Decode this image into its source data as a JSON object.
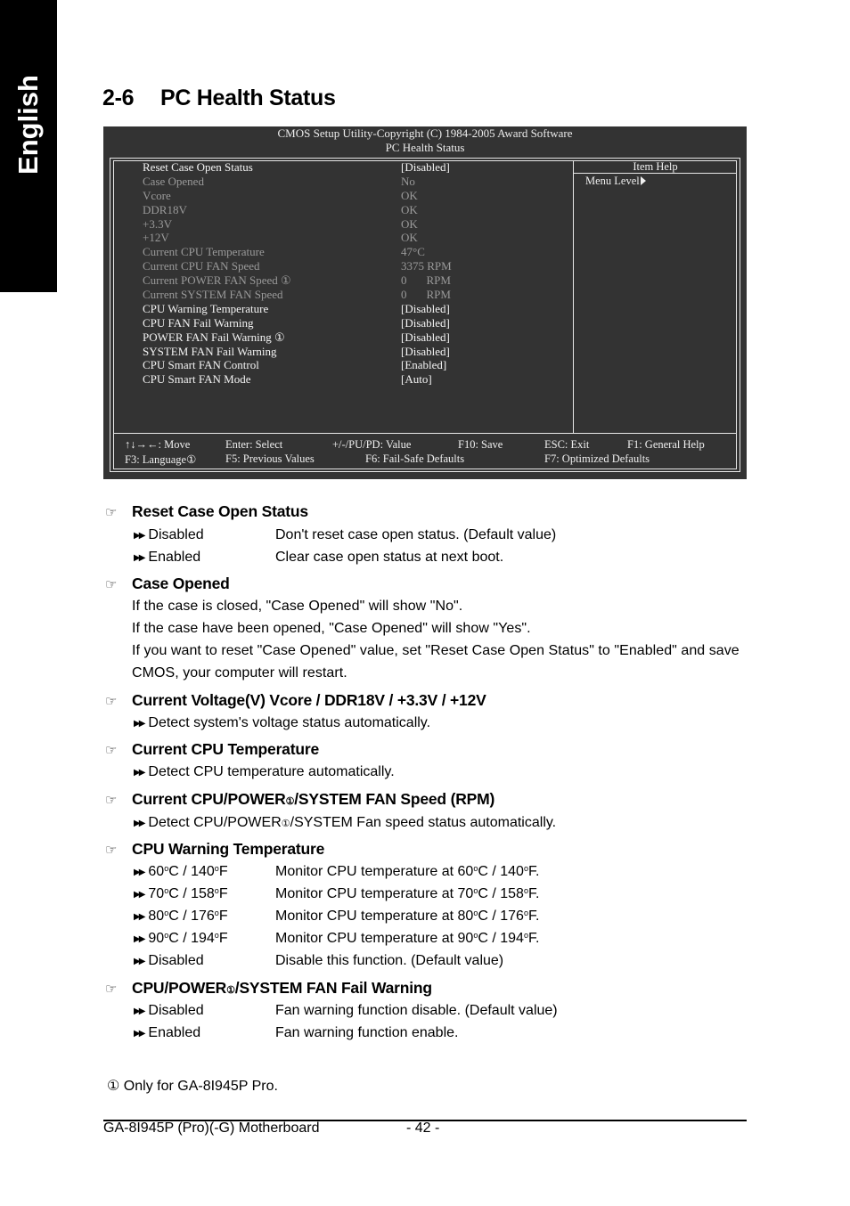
{
  "side_tab": {
    "label": "English"
  },
  "page_title": {
    "number": "2-6",
    "text": "PC Health Status"
  },
  "bios": {
    "header_line1": "CMOS Setup Utility-Copyright (C) 1984-2005 Award Software",
    "header_line2": "PC Health Status",
    "rows": [
      {
        "label": "Reset Case Open Status",
        "value": "[Disabled]",
        "state": "active"
      },
      {
        "label": "Case Opened",
        "value": "No",
        "state": "readonly"
      },
      {
        "label": "Vcore",
        "value": "OK",
        "state": "readonly"
      },
      {
        "label": "DDR18V",
        "value": "OK",
        "state": "readonly"
      },
      {
        "label": "+3.3V",
        "value": "OK",
        "state": "readonly"
      },
      {
        "label": "+12V",
        "value": "OK",
        "state": "readonly"
      },
      {
        "label": "Current CPU Temperature",
        "value": "47°C",
        "state": "readonly"
      },
      {
        "label": "Current CPU FAN Speed",
        "value": "3375 RPM",
        "state": "readonly"
      },
      {
        "label": "Current POWER FAN Speed ①",
        "value": "0",
        "unit": "RPM",
        "state": "readonly"
      },
      {
        "label": "Current SYSTEM FAN Speed",
        "value": "0",
        "unit": "RPM",
        "state": "readonly"
      },
      {
        "label": "CPU Warning Temperature",
        "value": "[Disabled]",
        "state": "active"
      },
      {
        "label": "CPU FAN Fail Warning",
        "value": "[Disabled]",
        "state": "active"
      },
      {
        "label": "POWER FAN Fail Warning ①",
        "value": "[Disabled]",
        "state": "active"
      },
      {
        "label": "SYSTEM FAN Fail Warning",
        "value": "[Disabled]",
        "state": "active"
      },
      {
        "label": "CPU Smart FAN Control",
        "value": "[Enabled]",
        "state": "active"
      },
      {
        "label": "CPU Smart FAN Mode",
        "value": "[Auto]",
        "state": "active"
      }
    ],
    "item_help_title": "Item Help",
    "menu_level": "Menu Level",
    "keys_row1": [
      "↑↓→←: Move",
      "Enter: Select",
      "+/-/PU/PD: Value",
      "F10: Save",
      "ESC: Exit",
      "F1: General Help"
    ],
    "keys_row2": [
      "F3: Language①",
      "F5: Previous Values",
      "F6: Fail-Safe Defaults",
      "F7: Optimized Defaults"
    ]
  },
  "sections": {
    "reset_case": {
      "title": "Reset Case Open Status",
      "options": [
        {
          "name": "Disabled",
          "desc": "Don't reset case open status. (Default value)"
        },
        {
          "name": "Enabled",
          "desc": "Clear case open status at next boot."
        }
      ]
    },
    "case_opened": {
      "title": "Case Opened",
      "lines": [
        "If the case is closed, \"Case Opened\" will show \"No\".",
        "If the case have been opened, \"Case Opened\" will show \"Yes\".",
        "If you want to reset \"Case Opened\" value, set \"Reset Case Open Status\" to \"Enabled\" and save",
        "CMOS, your computer will restart."
      ]
    },
    "voltage": {
      "title": "Current Voltage(V) Vcore / DDR18V / +3.3V / +12V",
      "line": "Detect system's voltage status automatically."
    },
    "cpu_temp": {
      "title": "Current CPU Temperature",
      "line": "Detect CPU temperature automatically."
    },
    "fan_speed": {
      "title_a": "Current CPU/POWER",
      "title_b": "/SYSTEM FAN Speed (RPM)",
      "line_a": "Detect CPU/POWER",
      "line_b": "/SYSTEM Fan speed status automatically."
    },
    "warn_temp": {
      "title": "CPU Warning Temperature",
      "options": [
        {
          "c": "60",
          "f": "140"
        },
        {
          "c": "70",
          "f": "158"
        },
        {
          "c": "80",
          "f": "176"
        },
        {
          "c": "90",
          "f": "194"
        }
      ],
      "desc_prefix": "Monitor CPU temperature at ",
      "disabled_name": "Disabled",
      "disabled_desc": "Disable this function. (Default value)"
    },
    "fan_fail": {
      "title_a": "CPU/POWER",
      "title_b": "/SYSTEM FAN Fail Warning",
      "options": [
        {
          "name": "Disabled",
          "desc": "Fan warning function disable. (Default value)"
        },
        {
          "name": "Enabled",
          "desc": "Fan warning function enable."
        }
      ]
    }
  },
  "footnote_mark": "①",
  "footnote": "Only for GA-8I945P Pro.",
  "footer": {
    "product": "GA-8I945P (Pro)(-G) Motherboard",
    "page": "- 42 -"
  }
}
